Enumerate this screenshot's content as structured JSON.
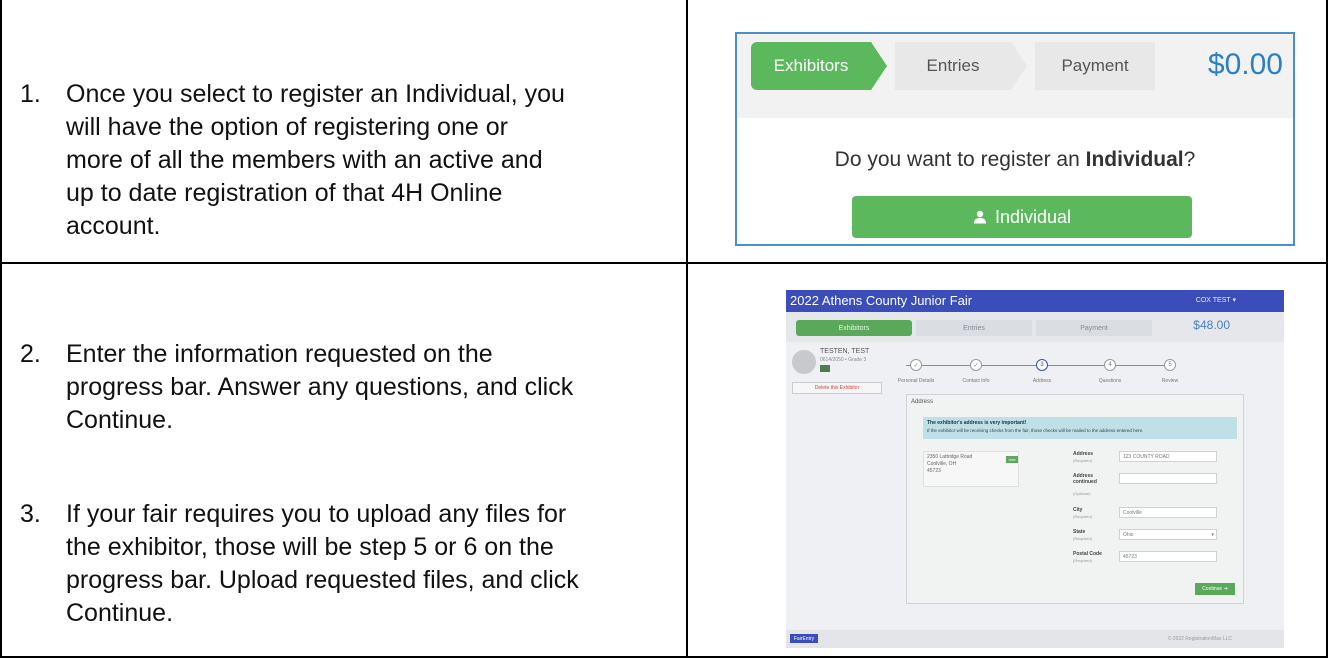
{
  "instructions": [
    {
      "number": "1.",
      "lines": [
        "Once you select to register an Individual, you",
        "will have the option of registering one or",
        "more of all the members with an active and",
        "up to date registration of that 4H Online",
        "account."
      ]
    },
    {
      "number": "2.",
      "lines": [
        "Enter the information requested on the",
        "progress bar.  Answer any questions, and click",
        "Continue."
      ]
    },
    {
      "number": "3.",
      "lines": [
        "If your fair requires you to upload any files for",
        "the exhibitor, those will be step 5 or 6 on the",
        "progress bar. Upload requested files, and click",
        "Continue."
      ]
    }
  ],
  "register_screen": {
    "steps": [
      "Exhibitors",
      "Entries",
      "Payment"
    ],
    "total": "$0.00",
    "question_prefix": "Do you want to register an ",
    "question_bold": "Individual",
    "question_suffix": "?",
    "button_label": "Individual",
    "button_icon": "user-icon",
    "colors": {
      "green": "#5cb85c",
      "blue_total": "#2b7fc4",
      "border": "#4a90c8"
    }
  },
  "exhibitor_screen": {
    "title": "2022 Athens County Junior Fair",
    "user": "COX TEST ▾",
    "steps": [
      "Exhibitors",
      "Entries",
      "Payment"
    ],
    "total": "$48.00",
    "exhibitor_name": "TESTEN, TEST",
    "exhibitor_sub": "0614/2050 • Grade 3",
    "delete_label": "Delete this Exhibitor",
    "wizard_steps": [
      "Personal Details",
      "Contact Info",
      "Address",
      "Questions",
      "Review"
    ],
    "panel_title": "Address",
    "alert_title": "The exhibitor's address is very important!",
    "alert_text": "If the exhibitor will be receiving checks from the fair, those checks will be mailed to the address entered here.",
    "address_card": [
      "2350 Lattridge Road",
      "Coolville, OH",
      "45723"
    ],
    "use_label": "Use",
    "fields": [
      {
        "label": "Address",
        "required": "(Required)",
        "value": "123 COUNTY ROAD"
      },
      {
        "label": "Address continued",
        "required": "(Optional)",
        "value": ""
      },
      {
        "label": "City",
        "required": "(Required)",
        "value": "Coolville"
      },
      {
        "label": "State",
        "required": "(Required)",
        "value": "Ohio"
      },
      {
        "label": "Postal Code",
        "required": "(Required)",
        "value": "45723"
      }
    ],
    "continue_label": "Continue",
    "logo": "FairEntry",
    "copyright": "© 2022 RegistrationMax LLC"
  }
}
